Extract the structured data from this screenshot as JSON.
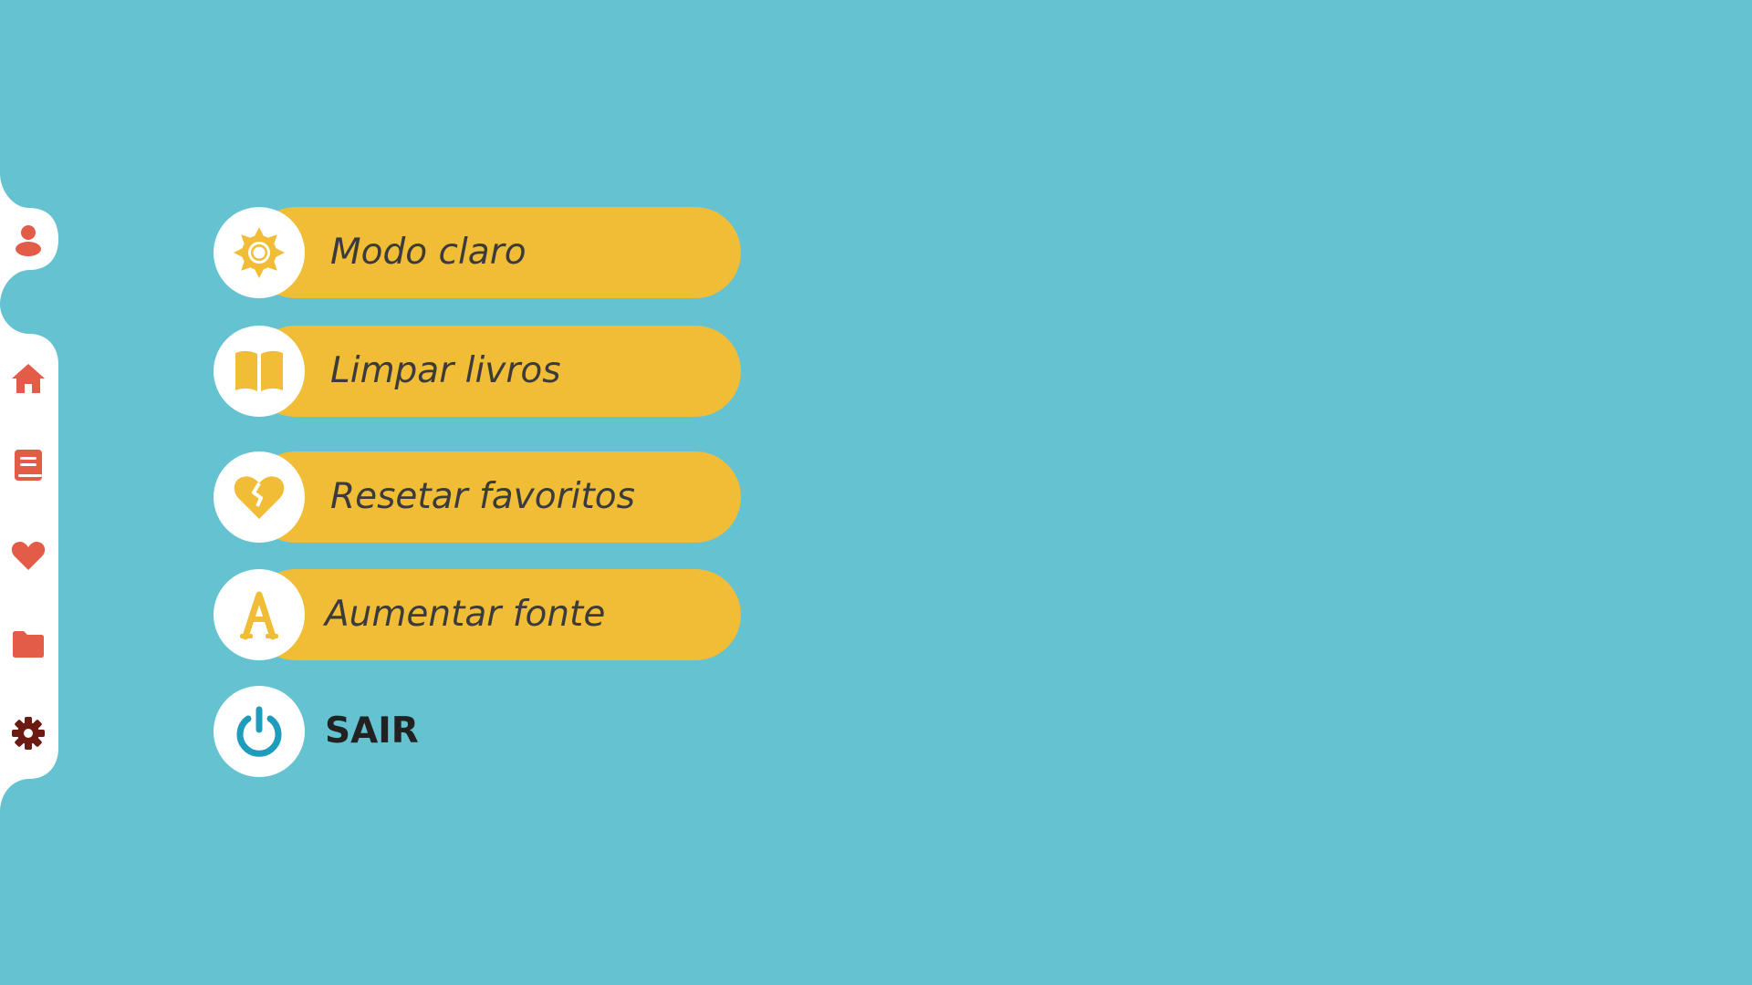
{
  "colors": {
    "background": "#65c3d1",
    "sidebar": "#ffffff",
    "sidebar_icon": "#e25c48",
    "sidebar_active_icon": "#6b1b12",
    "button": "#f1bd36",
    "button_icon": "#f1bd36",
    "power_icon": "#1e9cbb",
    "label_text": "#3b3b3b"
  },
  "sidebar": {
    "items": [
      {
        "name": "profile",
        "icon": "user-icon"
      },
      {
        "name": "home",
        "icon": "home-icon"
      },
      {
        "name": "books",
        "icon": "book-icon"
      },
      {
        "name": "favorites",
        "icon": "heart-icon"
      },
      {
        "name": "folders",
        "icon": "folder-icon"
      },
      {
        "name": "settings",
        "icon": "gear-icon",
        "active": true
      }
    ]
  },
  "settings": {
    "items": [
      {
        "id": "light-mode",
        "label": "Modo claro",
        "icon": "sun-icon"
      },
      {
        "id": "clear-books",
        "label": "Limpar livros",
        "icon": "open-book-icon"
      },
      {
        "id": "reset-favorites",
        "label": "Resetar favoritos",
        "icon": "broken-heart-icon"
      },
      {
        "id": "increase-font",
        "label": "Aumentar fonte",
        "icon": "font-a-icon"
      }
    ],
    "logout": {
      "label": "SAIR",
      "icon": "power-icon"
    }
  }
}
